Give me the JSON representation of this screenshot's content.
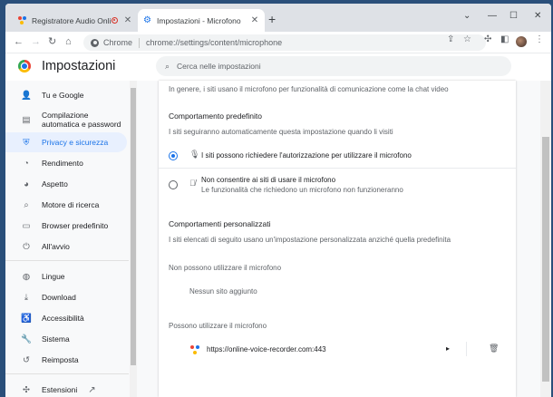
{
  "tabs": [
    {
      "title": "Registratore Audio Online - F",
      "close": "✕"
    },
    {
      "title": "Impostazioni - Microfono",
      "close": "✕"
    }
  ],
  "new_tab": "+",
  "window_controls": {
    "dropdown": "⌄",
    "minimize": "—",
    "maximize": "☐",
    "close": "✕"
  },
  "toolbar": {
    "back": "←",
    "forward": "→",
    "reload": "↻",
    "home": "⌂",
    "scheme": "Chrome",
    "url": "chrome://settings/content/microphone"
  },
  "settings": {
    "title": "Impostazioni",
    "search_placeholder": "Cerca nelle impostazioni"
  },
  "sidebar": {
    "items": [
      {
        "label": "Tu e Google",
        "icon": "person-icon",
        "glyph": "👤"
      },
      {
        "label": "Compilazione automatica e password",
        "icon": "clipboard-icon",
        "glyph": "▤"
      },
      {
        "label": "Privacy e sicurezza",
        "icon": "shield-icon",
        "glyph": "⛨"
      },
      {
        "label": "Rendimento",
        "icon": "speedometer-icon",
        "glyph": "◔"
      },
      {
        "label": "Aspetto",
        "icon": "palette-icon",
        "glyph": "◕"
      },
      {
        "label": "Motore di ricerca",
        "icon": "search-icon",
        "glyph": "⌕"
      },
      {
        "label": "Browser predefinito",
        "icon": "browser-icon",
        "glyph": "▭"
      },
      {
        "label": "All'avvio",
        "icon": "power-icon",
        "glyph": "⏻"
      },
      {
        "label": "Lingue",
        "icon": "globe-icon",
        "glyph": "◍"
      },
      {
        "label": "Download",
        "icon": "download-icon",
        "glyph": "⤓"
      },
      {
        "label": "Accessibilità",
        "icon": "accessibility-icon",
        "glyph": "♿"
      },
      {
        "label": "Sistema",
        "icon": "wrench-icon",
        "glyph": "🔧"
      },
      {
        "label": "Reimposta",
        "icon": "reset-icon",
        "glyph": "↺"
      },
      {
        "label": "Estensioni",
        "icon": "puzzle-icon",
        "glyph": "✣"
      }
    ],
    "selected_index": 2,
    "external_link": "↗"
  },
  "content": {
    "intro": "In genere, i siti usano il microfono per funzionalità di comunicazione come la chat video",
    "default_behavior": {
      "heading": "Comportamento predefinito",
      "subtitle": "I siti seguiranno automaticamente questa impostazione quando li visiti",
      "options": [
        {
          "label": "I siti possono richiedere l'autorizzazione per utilizzare il microfono",
          "sublabel": "",
          "checked": true,
          "icon": "microphone-icon"
        },
        {
          "label": "Non consentire ai siti di usare il microfono",
          "sublabel": "Le funzionalità che richiedono un microfono non funzioneranno",
          "checked": false,
          "icon": "microphone-off-icon"
        }
      ]
    },
    "custom_behaviors": {
      "heading": "Comportamenti personalizzati",
      "subtitle": "I siti elencati di seguito usano un'impostazione personalizzata anziché quella predefinita",
      "blocked_heading": "Non possono utilizzare il microfono",
      "blocked_empty": "Nessun sito aggiunto",
      "allowed_heading": "Possono utilizzare il microfono",
      "allowed_sites": [
        {
          "url": "https://online-voice-recorder.com:443",
          "expand": "▸",
          "delete": "🗑"
        }
      ]
    }
  },
  "colors": {
    "accent": "#1a73e8",
    "selected_bg": "#e8f0fe"
  }
}
